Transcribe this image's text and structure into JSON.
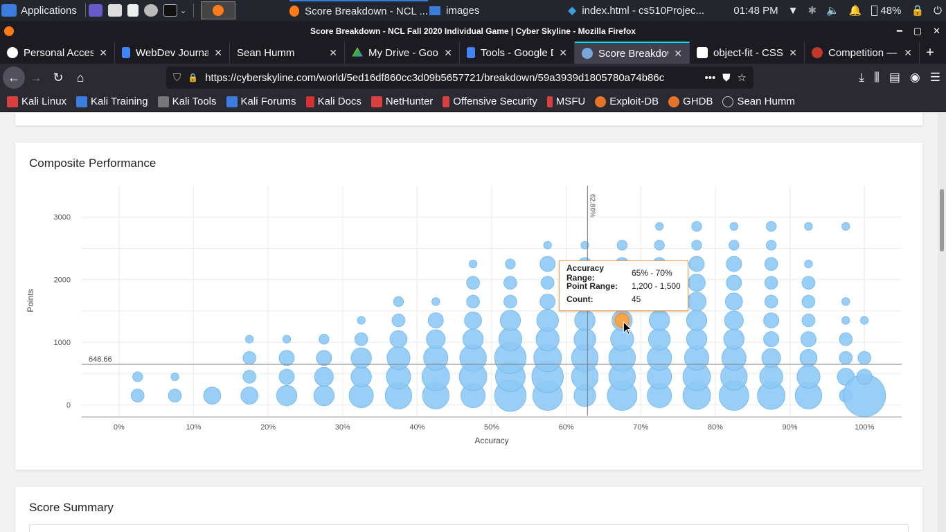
{
  "taskbar": {
    "applications_label": "Applications",
    "task1": "Score Breakdown - NCL ...",
    "task2": "images",
    "task3": "index.html - cs510Projec...",
    "time": "01:48 PM",
    "battery": "48%"
  },
  "window": {
    "title": "Score Breakdown - NCL Fall 2020 Individual Game | Cyber Skyline - Mozilla Firefox"
  },
  "tabs": [
    {
      "label": "Personal Access",
      "icon": "github-icon",
      "color": "#ffffff"
    },
    {
      "label": "WebDev Journal",
      "icon": "docs-icon",
      "color": "#4285f4"
    },
    {
      "label": "Sean Humm",
      "icon": "",
      "color": ""
    },
    {
      "label": "My Drive - Goog",
      "icon": "drive-icon",
      "color": "#34a853"
    },
    {
      "label": "Tools - Google D",
      "icon": "docs-icon",
      "color": "#4285f4"
    },
    {
      "label": "Score Breakdow",
      "icon": "cyberskyline-icon",
      "color": "#7aa7d9"
    },
    {
      "label": "object-fit - CSS",
      "icon": "mdn-icon",
      "color": "#ffffff"
    },
    {
      "label": "Competition —",
      "icon": "competition-icon",
      "color": "#c0392b"
    }
  ],
  "navbar": {
    "url": "https://cyberskyline.com/world/5ed16df860cc3d09b5657721/breakdown/59a3939d1805780a74b86c"
  },
  "bookmarks": [
    {
      "label": "Kali Linux",
      "color": "#d94141"
    },
    {
      "label": "Kali Training",
      "color": "#3b7ddd"
    },
    {
      "label": "Kali Tools",
      "color": "#777777"
    },
    {
      "label": "Kali Forums",
      "color": "#3b7ddd"
    },
    {
      "label": "Kali Docs",
      "color": "#d43333"
    },
    {
      "label": "NetHunter",
      "color": "#d94141"
    },
    {
      "label": "Offensive Security",
      "color": "#d94141"
    },
    {
      "label": "MSFU",
      "color": "#d94141"
    },
    {
      "label": "Exploit-DB",
      "color": "#e8742a"
    },
    {
      "label": "GHDB",
      "color": "#e8742a"
    },
    {
      "label": "Sean Humm",
      "color": "#cccccc"
    }
  ],
  "card": {
    "title": "Composite Performance"
  },
  "card2": {
    "title": "Score Summary"
  },
  "tooltip": {
    "rows": [
      {
        "k": "Accuracy Range:",
        "v": "65% - 70%"
      },
      {
        "k": "Point Range:",
        "v": "1,200 - 1,500"
      },
      {
        "k": "Count:",
        "v": "45"
      }
    ]
  },
  "chart_data": {
    "type": "scatter",
    "title": "",
    "xlabel": "Accuracy",
    "ylabel": "Points",
    "xlim": [
      -5,
      105
    ],
    "ylim": [
      -170,
      3500
    ],
    "xticks": [
      "0%",
      "10%",
      "20%",
      "30%",
      "40%",
      "50%",
      "60%",
      "70%",
      "80%",
      "90%",
      "100%"
    ],
    "yticks": [
      "0",
      "1000",
      "2000",
      "3000"
    ],
    "reference_lines": [
      {
        "axis": "x",
        "value": 62.86,
        "label": "62.86%"
      },
      {
        "axis": "y",
        "value": 648.66,
        "label": "648.66"
      }
    ],
    "bubble_color": "#8ec9f5",
    "highlight_color": "#f5a54a",
    "highlight": {
      "x": 67.5,
      "y": 1350
    },
    "points": [
      [
        2.5,
        150,
        2
      ],
      [
        2.5,
        450,
        1
      ],
      [
        7.5,
        150,
        2
      ],
      [
        7.5,
        450,
        0.5
      ],
      [
        12.5,
        150,
        4
      ],
      [
        17.5,
        150,
        4
      ],
      [
        17.5,
        450,
        2
      ],
      [
        17.5,
        750,
        2
      ],
      [
        17.5,
        1050,
        0.5
      ],
      [
        22.5,
        150,
        6
      ],
      [
        22.5,
        450,
        3
      ],
      [
        22.5,
        750,
        3
      ],
      [
        22.5,
        1050,
        0.5
      ],
      [
        27.5,
        150,
        6
      ],
      [
        27.5,
        450,
        5
      ],
      [
        27.5,
        750,
        3
      ],
      [
        27.5,
        1050,
        1
      ],
      [
        32.5,
        150,
        9
      ],
      [
        32.5,
        450,
        6
      ],
      [
        32.5,
        750,
        6
      ],
      [
        32.5,
        1050,
        2
      ],
      [
        32.5,
        1350,
        0.5
      ],
      [
        37.5,
        150,
        11
      ],
      [
        37.5,
        450,
        9
      ],
      [
        37.5,
        750,
        8
      ],
      [
        37.5,
        1050,
        4
      ],
      [
        37.5,
        1350,
        2
      ],
      [
        37.5,
        1650,
        1
      ],
      [
        42.5,
        150,
        11
      ],
      [
        42.5,
        450,
        12
      ],
      [
        42.5,
        750,
        9
      ],
      [
        42.5,
        1050,
        5
      ],
      [
        42.5,
        1350,
        3
      ],
      [
        42.5,
        1650,
        0.5
      ],
      [
        47.5,
        150,
        9
      ],
      [
        47.5,
        450,
        12
      ],
      [
        47.5,
        750,
        11
      ],
      [
        47.5,
        1050,
        6
      ],
      [
        47.5,
        1350,
        4
      ],
      [
        47.5,
        1650,
        2
      ],
      [
        47.5,
        1950,
        2
      ],
      [
        47.5,
        2250,
        0.5
      ],
      [
        52.5,
        150,
        16
      ],
      [
        52.5,
        450,
        14
      ],
      [
        52.5,
        750,
        16
      ],
      [
        52.5,
        1050,
        8
      ],
      [
        52.5,
        1350,
        6
      ],
      [
        52.5,
        1650,
        2
      ],
      [
        52.5,
        1950,
        2
      ],
      [
        52.5,
        2250,
        1
      ],
      [
        57.5,
        150,
        14
      ],
      [
        57.5,
        450,
        16
      ],
      [
        57.5,
        750,
        12
      ],
      [
        57.5,
        1050,
        8
      ],
      [
        57.5,
        1350,
        7
      ],
      [
        57.5,
        1650,
        3
      ],
      [
        57.5,
        1950,
        2
      ],
      [
        57.5,
        2250,
        3
      ],
      [
        57.5,
        2550,
        0.5
      ],
      [
        62.5,
        150,
        7
      ],
      [
        62.5,
        450,
        11
      ],
      [
        62.5,
        750,
        11
      ],
      [
        62.5,
        1050,
        7
      ],
      [
        62.5,
        1350,
        6
      ],
      [
        62.5,
        1650,
        3
      ],
      [
        62.5,
        1950,
        2
      ],
      [
        62.5,
        2250,
        2
      ],
      [
        62.5,
        2550,
        0.5
      ],
      [
        67.5,
        150,
        14
      ],
      [
        67.5,
        450,
        11
      ],
      [
        67.5,
        750,
        11
      ],
      [
        67.5,
        1050,
        8
      ],
      [
        67.5,
        1350,
        6
      ],
      [
        67.5,
        1650,
        3
      ],
      [
        67.5,
        1950,
        3
      ],
      [
        67.5,
        2250,
        2
      ],
      [
        67.5,
        2550,
        1
      ],
      [
        72.5,
        150,
        9
      ],
      [
        72.5,
        450,
        9
      ],
      [
        72.5,
        750,
        9
      ],
      [
        72.5,
        1050,
        7
      ],
      [
        72.5,
        1350,
        6
      ],
      [
        72.5,
        1650,
        4
      ],
      [
        72.5,
        1950,
        3
      ],
      [
        72.5,
        2250,
        2
      ],
      [
        72.5,
        2550,
        1
      ],
      [
        72.5,
        2850,
        0.5
      ],
      [
        77.5,
        150,
        12
      ],
      [
        77.5,
        450,
        12
      ],
      [
        77.5,
        750,
        9
      ],
      [
        77.5,
        1050,
        6
      ],
      [
        77.5,
        1350,
        6
      ],
      [
        77.5,
        1650,
        5
      ],
      [
        77.5,
        1950,
        4
      ],
      [
        77.5,
        2250,
        3
      ],
      [
        77.5,
        2550,
        1
      ],
      [
        77.5,
        2850,
        1
      ],
      [
        82.5,
        150,
        14
      ],
      [
        82.5,
        450,
        11
      ],
      [
        82.5,
        750,
        9
      ],
      [
        82.5,
        1050,
        6
      ],
      [
        82.5,
        1350,
        5
      ],
      [
        82.5,
        1650,
        4
      ],
      [
        82.5,
        1950,
        3
      ],
      [
        82.5,
        2250,
        3
      ],
      [
        82.5,
        2550,
        1
      ],
      [
        82.5,
        2850,
        0.5
      ],
      [
        87.5,
        150,
        12
      ],
      [
        87.5,
        450,
        8
      ],
      [
        87.5,
        750,
        5
      ],
      [
        87.5,
        1050,
        3
      ],
      [
        87.5,
        1350,
        3
      ],
      [
        87.5,
        1650,
        2
      ],
      [
        87.5,
        1950,
        2
      ],
      [
        87.5,
        2250,
        2
      ],
      [
        87.5,
        2550,
        1
      ],
      [
        87.5,
        2850,
        1
      ],
      [
        92.5,
        150,
        11
      ],
      [
        92.5,
        450,
        8
      ],
      [
        92.5,
        750,
        4
      ],
      [
        92.5,
        1050,
        3
      ],
      [
        92.5,
        1350,
        2
      ],
      [
        92.5,
        1650,
        2
      ],
      [
        92.5,
        1950,
        2
      ],
      [
        92.5,
        2250,
        0.5
      ],
      [
        92.5,
        2850,
        0.5
      ],
      [
        97.5,
        150,
        2
      ],
      [
        97.5,
        450,
        4
      ],
      [
        97.5,
        750,
        2
      ],
      [
        97.5,
        1050,
        2
      ],
      [
        97.5,
        1350,
        0.5
      ],
      [
        97.5,
        1650,
        0.5
      ],
      [
        97.5,
        2850,
        0.5
      ],
      [
        100,
        150,
        30
      ],
      [
        100,
        450,
        3
      ],
      [
        100,
        750,
        2
      ],
      [
        100,
        1350,
        0.5
      ]
    ]
  }
}
